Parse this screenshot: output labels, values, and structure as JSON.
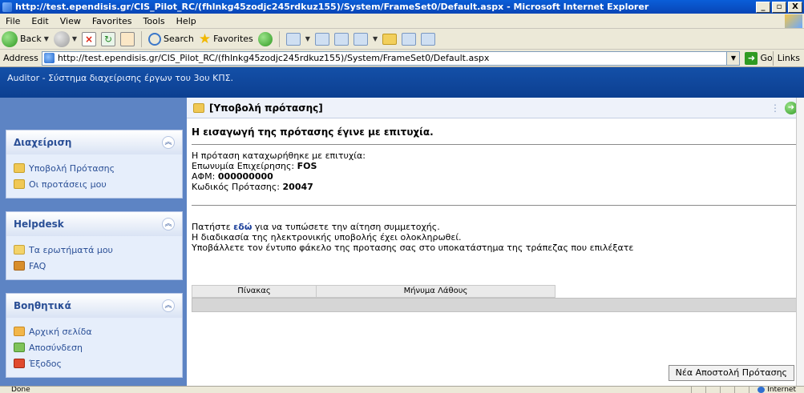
{
  "window": {
    "title": "http://test.ependisis.gr/CIS_Pilot_RC/(fhlnkg45zodjc245rdkuz155)/System/FrameSet0/Default.aspx - Microsoft Internet Explorer",
    "min": "_",
    "restore": "▫",
    "close": "X"
  },
  "menu": [
    "File",
    "Edit",
    "View",
    "Favorites",
    "Tools",
    "Help"
  ],
  "toolbar": {
    "back": "Back",
    "search": "Search",
    "favorites": "Favorites"
  },
  "address": {
    "label": "Address",
    "url": "http://test.ependisis.gr/CIS_Pilot_RC/(fhlnkg45zodjc245rdkuz155)/System/FrameSet0/Default.aspx",
    "go": "Go",
    "links": "Links"
  },
  "app": {
    "title": "Auditor - Σύστημα διαχείρισης έργων του 3ου ΚΠΣ."
  },
  "sidebar": {
    "panels": [
      {
        "title": "Διαχείριση",
        "items": [
          "Υποβολή Πρότασης",
          "Οι προτάσεις μου"
        ]
      },
      {
        "title": "Helpdesk",
        "items": [
          "Τα ερωτήματά μου",
          "FAQ"
        ]
      },
      {
        "title": "Βοηθητικά",
        "items": [
          "Αρχική σελίδα",
          "Αποσύνδεση",
          "Έξοδος"
        ]
      }
    ]
  },
  "main": {
    "header": "[Υποβολή πρότασης]",
    "success": "Η εισαγωγή της πρότασης έγινε με επιτυχία.",
    "line1": "Η πρόταση καταχωρήθηκε με επιτυχία:",
    "company_label": "Επωνυμία Επιχείρησης: ",
    "company_value": "FOS",
    "afm_label": "ΑΦΜ: ",
    "afm_value": "000000000",
    "code_label": "Κωδικός Πρότασης: ",
    "code_value": "20047",
    "press_prefix": "Πατήστε ",
    "press_link": "εδώ",
    "press_suffix": " για να τυπώσετε την αίτηση συμμετοχής.",
    "process_done": "Η διαδικασία της ηλεκτρονικής υποβολής έχει ολοκληρωθεί.",
    "submit_note": "Υποβάλλετε τον έντυπο φάκελο της προτασης σας στο υποκατάστημα της τράπεζας που επιλέξατε",
    "table_col1": "Πίνακας",
    "table_col2": "Μήνυμα Λάθους",
    "new_button": "Νέα Αποστολή Πρότασης"
  },
  "status": {
    "left": "Done",
    "zone": "Internet"
  }
}
